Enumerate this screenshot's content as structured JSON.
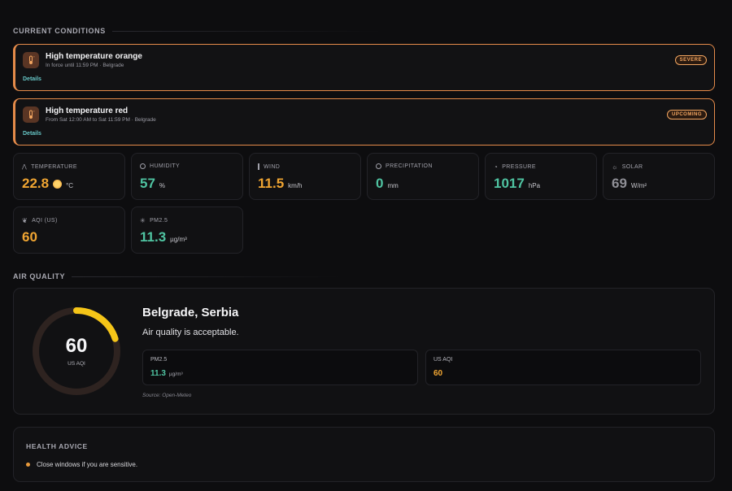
{
  "sections": {
    "current": "CURRENT CONDITIONS",
    "air": "AIR QUALITY"
  },
  "alerts": [
    {
      "title": "High temperature orange",
      "subtitle": "In force until 11:59 PM · Belgrade",
      "details": "Details",
      "badge": "SEVERE",
      "icon": "thermometer-icon"
    },
    {
      "title": "High temperature red",
      "subtitle": "From Sat 12:00 AM to Sat 11:59 PM · Belgrade",
      "details": "Details",
      "badge": "UPCOMING",
      "icon": "thermometer-icon"
    }
  ],
  "metrics": [
    {
      "label": "TEMPERATURE",
      "value": "22.8",
      "unit": "°C",
      "icon": "thermometer-icon",
      "color": "#f0a532"
    },
    {
      "label": "HUMIDITY",
      "value": "57",
      "unit": "%",
      "icon": "circle-icon",
      "color": "#4fc3a1"
    },
    {
      "label": "WIND",
      "value": "11.5",
      "unit": "km/h",
      "icon": "wind-bar-icon",
      "color": "#f0a532"
    },
    {
      "label": "PRECIPITATION",
      "value": "0",
      "unit": "mm",
      "icon": "droplet-icon",
      "color": "#4fc3a1"
    },
    {
      "label": "PRESSURE",
      "value": "1017",
      "unit": "hPa",
      "icon": "gauge-icon",
      "color": "#4fc3a1"
    },
    {
      "label": "SOLAR",
      "value": "69",
      "unit": "W/m²",
      "icon": "sun-icon",
      "color": "#8f8f96"
    },
    {
      "label": "AQI (US)",
      "value": "60",
      "unit": "",
      "icon": "leaf-icon",
      "color": "#f0a532"
    },
    {
      "label": "PM2.5",
      "value": "11.3",
      "unit": "µg/m³",
      "icon": "sparkle-icon",
      "color": "#4fc3a1"
    }
  ],
  "air_quality": {
    "aqi": "60",
    "aqi_label": "US AQI",
    "aqi_fraction": 0.2,
    "city": "Belgrade, Serbia",
    "message": "Air quality is acceptable.",
    "pm25_label": "PM2.5",
    "pm25_value": "11.3",
    "pm25_unit": "µg/m³",
    "usaqi_label": "US AQI",
    "usaqi_value": "60",
    "source": "Source: Open-Meteo"
  },
  "health": {
    "title": "HEALTH ADVICE",
    "items": [
      "Close windows if you are sensitive."
    ]
  },
  "colors": {
    "accent_orange": "#e58b4a",
    "warm": "#f0a532",
    "teal": "#4fc3a1",
    "gauge": "#f5c518"
  }
}
